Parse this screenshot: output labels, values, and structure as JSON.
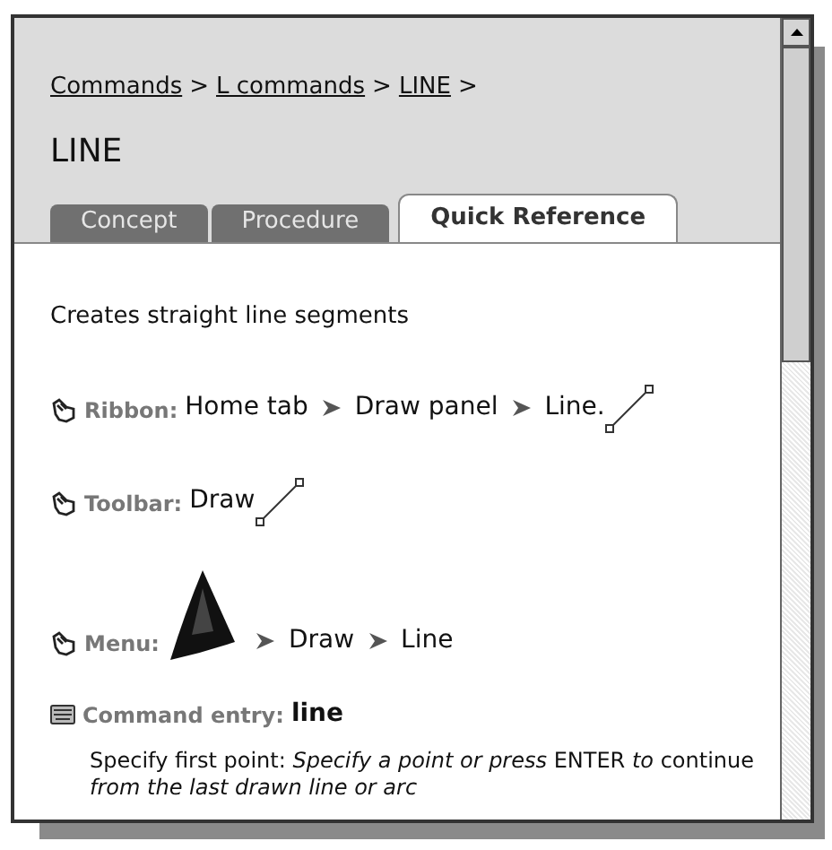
{
  "breadcrumb": [
    {
      "label": "Commands",
      "separator": ">"
    },
    {
      "label": "L commands",
      "separator": ">"
    },
    {
      "label": "LINE",
      "separator": ">"
    }
  ],
  "title": "LINE",
  "tabs": [
    {
      "label": "Concept",
      "selected": false
    },
    {
      "label": "Procedure",
      "selected": false
    },
    {
      "label": "Quick Reference",
      "selected": true
    }
  ],
  "description": "Creates straight line segments",
  "access": [
    {
      "kind": "ribbon",
      "label": "Ribbon:",
      "path": [
        "Home tab",
        "Draw panel",
        "Line."
      ]
    },
    {
      "kind": "toolbar",
      "label": "Toolbar:",
      "path": [
        "Draw"
      ]
    },
    {
      "kind": "menu",
      "label": "Menu:",
      "path": [
        "Draw",
        "Line"
      ]
    }
  ],
  "command_entry": {
    "label": "Command entry:",
    "value": "line",
    "prompt": "Specify first point: *Specify a point or press* ENTER *to* continue *from the last drawn line or arc*"
  }
}
